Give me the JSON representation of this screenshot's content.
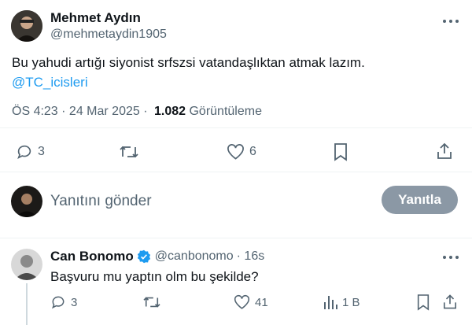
{
  "tweet": {
    "author_name": "Mehmet Aydın",
    "author_handle": "@mehmetaydin1905",
    "text": "Bu yahudi artığı siyonist srfszsi vatandaşlıktan atmak lazım.",
    "mention": "@TC_icisleri",
    "time": "ÖS 4:23 · 24 Mar 2025 ·",
    "views_count": "1.082",
    "views_label": "Görüntüleme",
    "replies": "3",
    "likes": "6",
    "icons": [
      "more-icon",
      "reply-icon",
      "retweet-icon",
      "like-icon",
      "bookmark-icon",
      "share-icon"
    ]
  },
  "composer": {
    "placeholder": "Yanıtını gönder",
    "reply_button": "Yanıtla"
  },
  "reply": {
    "author_name": "Can Bonomo",
    "author_handle": "@canbonomo",
    "time": "· 16s",
    "text": "Başvuru mu yaptın olm bu şekilde?",
    "replies": "3",
    "likes": "41",
    "views": "1 B",
    "icons": [
      "verified-icon",
      "more-icon",
      "reply-icon",
      "retweet-icon",
      "like-icon",
      "views-icon",
      "bookmark-icon",
      "share-icon"
    ]
  },
  "colors": {
    "link": "#1d9bf0",
    "muted": "#536471",
    "reply_button_bg": "#8b98a5",
    "verified": "#1d9bf0"
  }
}
